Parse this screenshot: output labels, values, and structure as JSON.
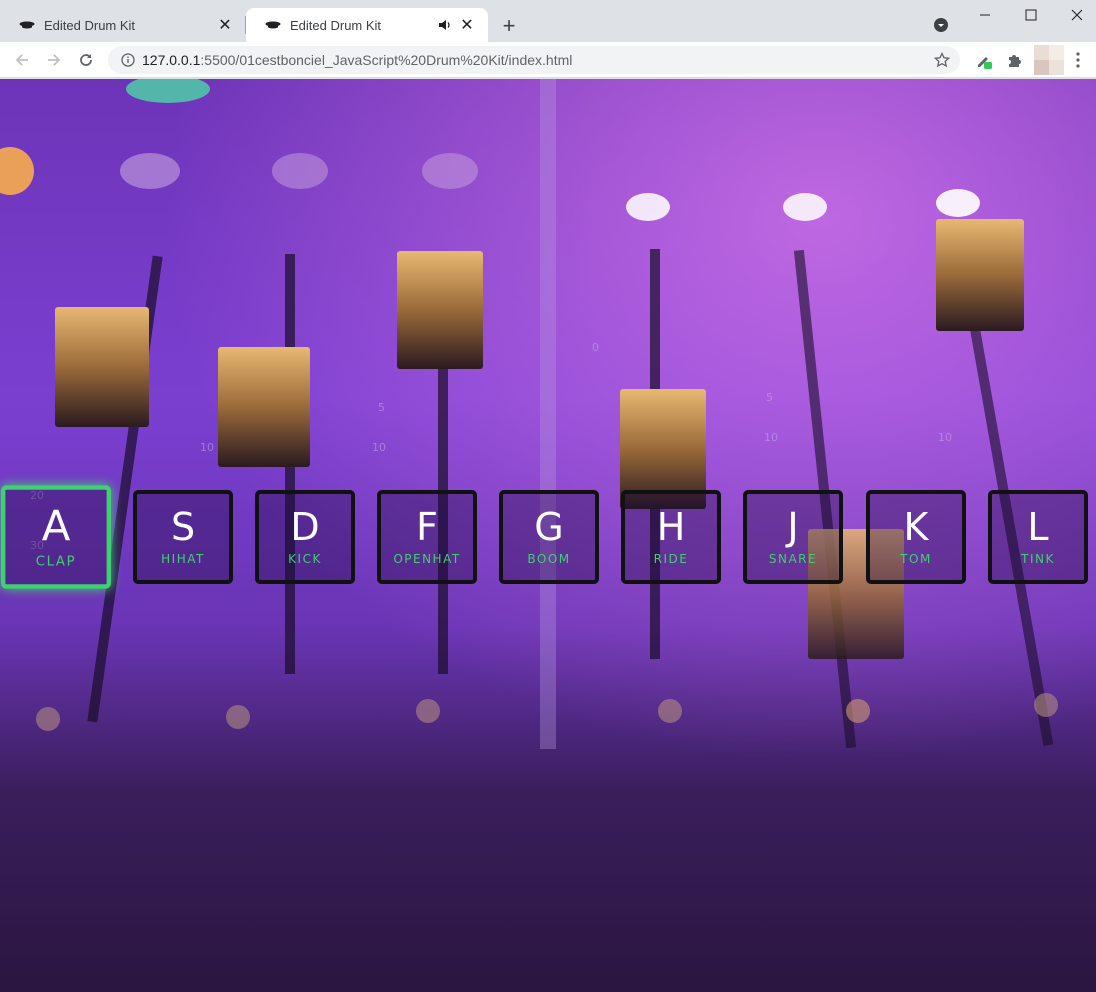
{
  "tabs": [
    {
      "title": "Edited Drum Kit",
      "active": false
    },
    {
      "title": "Edited Drum Kit",
      "active": true,
      "audio": true
    }
  ],
  "address_bar": {
    "host": "127.0.0.1",
    "path": ":5500/01cestbonciel_JavaScript%20Drum%20Kit/index.html"
  },
  "drum_keys": [
    {
      "key": "A",
      "sound": "clap",
      "playing": true
    },
    {
      "key": "S",
      "sound": "hihat",
      "playing": false
    },
    {
      "key": "D",
      "sound": "kick",
      "playing": false
    },
    {
      "key": "F",
      "sound": "openhat",
      "playing": false
    },
    {
      "key": "G",
      "sound": "boom",
      "playing": false
    },
    {
      "key": "H",
      "sound": "ride",
      "playing": false
    },
    {
      "key": "J",
      "sound": "snare",
      "playing": false
    },
    {
      "key": "K",
      "sound": "tom",
      "playing": false
    },
    {
      "key": "L",
      "sound": "tink",
      "playing": false
    }
  ],
  "colors": {
    "accent": "#3fd071",
    "key_border": "#111111",
    "tab_bar": "#dee1e6"
  },
  "icons": {
    "back": "arrow-left-icon",
    "forward": "arrow-right-icon",
    "reload": "reload-icon",
    "site_info": "info-icon",
    "bookmark": "star-icon",
    "extensions": "puzzle-icon",
    "menu": "kebab-menu-icon"
  }
}
